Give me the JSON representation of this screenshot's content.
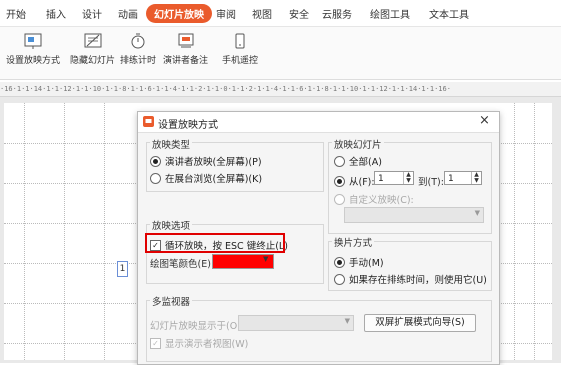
{
  "tabs": [
    "开始",
    "插入",
    "设计",
    "动画",
    "幻灯片放映",
    "审阅",
    "视图",
    "安全",
    "云服务",
    "绘图工具",
    "文本工具"
  ],
  "active_tab": "幻灯片放映",
  "ribbon": [
    "设置放映方式",
    "隐藏幻灯片",
    "排练计时",
    "演讲者备注",
    "手机遥控"
  ],
  "ruler_text": "·16·1·1·14·1·1·12·1·1·10·1·1·8·1·1·6·1·1·4·1·1·2·1·1·0·1·1·2·1·1·4·1·1·6·1·1·8·1·1·10·1·1·12·1·1·14·1·1·16·",
  "dialog": {
    "title": "设置放映方式",
    "close": "×",
    "show_type": {
      "label": "放映类型",
      "speaker": "演讲者放映(全屏幕)(P)",
      "kiosk": "在展台浏览(全屏幕)(K)"
    },
    "slides": {
      "label": "放映幻灯片",
      "all": "全部(A)",
      "from": "从(F):",
      "from_value": "1",
      "to": "到(T):",
      "to_value": "1",
      "custom": "自定义放映(C):"
    },
    "options": {
      "label": "放映选项",
      "loop": "循环放映，按 ESC 键终止(L)",
      "pen_color": "绘图笔颜色(E):"
    },
    "advance": {
      "label": "换片方式",
      "manual": "手动(M)",
      "timings": "如果存在排练时间，则使用它(U)"
    },
    "monitors": {
      "label": "多监视器",
      "display_on": "幻灯片放映显示于(O):",
      "wizard": "双屏扩展模式向导(S)",
      "presenter_view": "显示演示者视图(W)"
    }
  },
  "slide_number": "1",
  "colors": {
    "accent": "#ea5b2c",
    "pen": "#ff0000",
    "highlight": "#e00000"
  }
}
